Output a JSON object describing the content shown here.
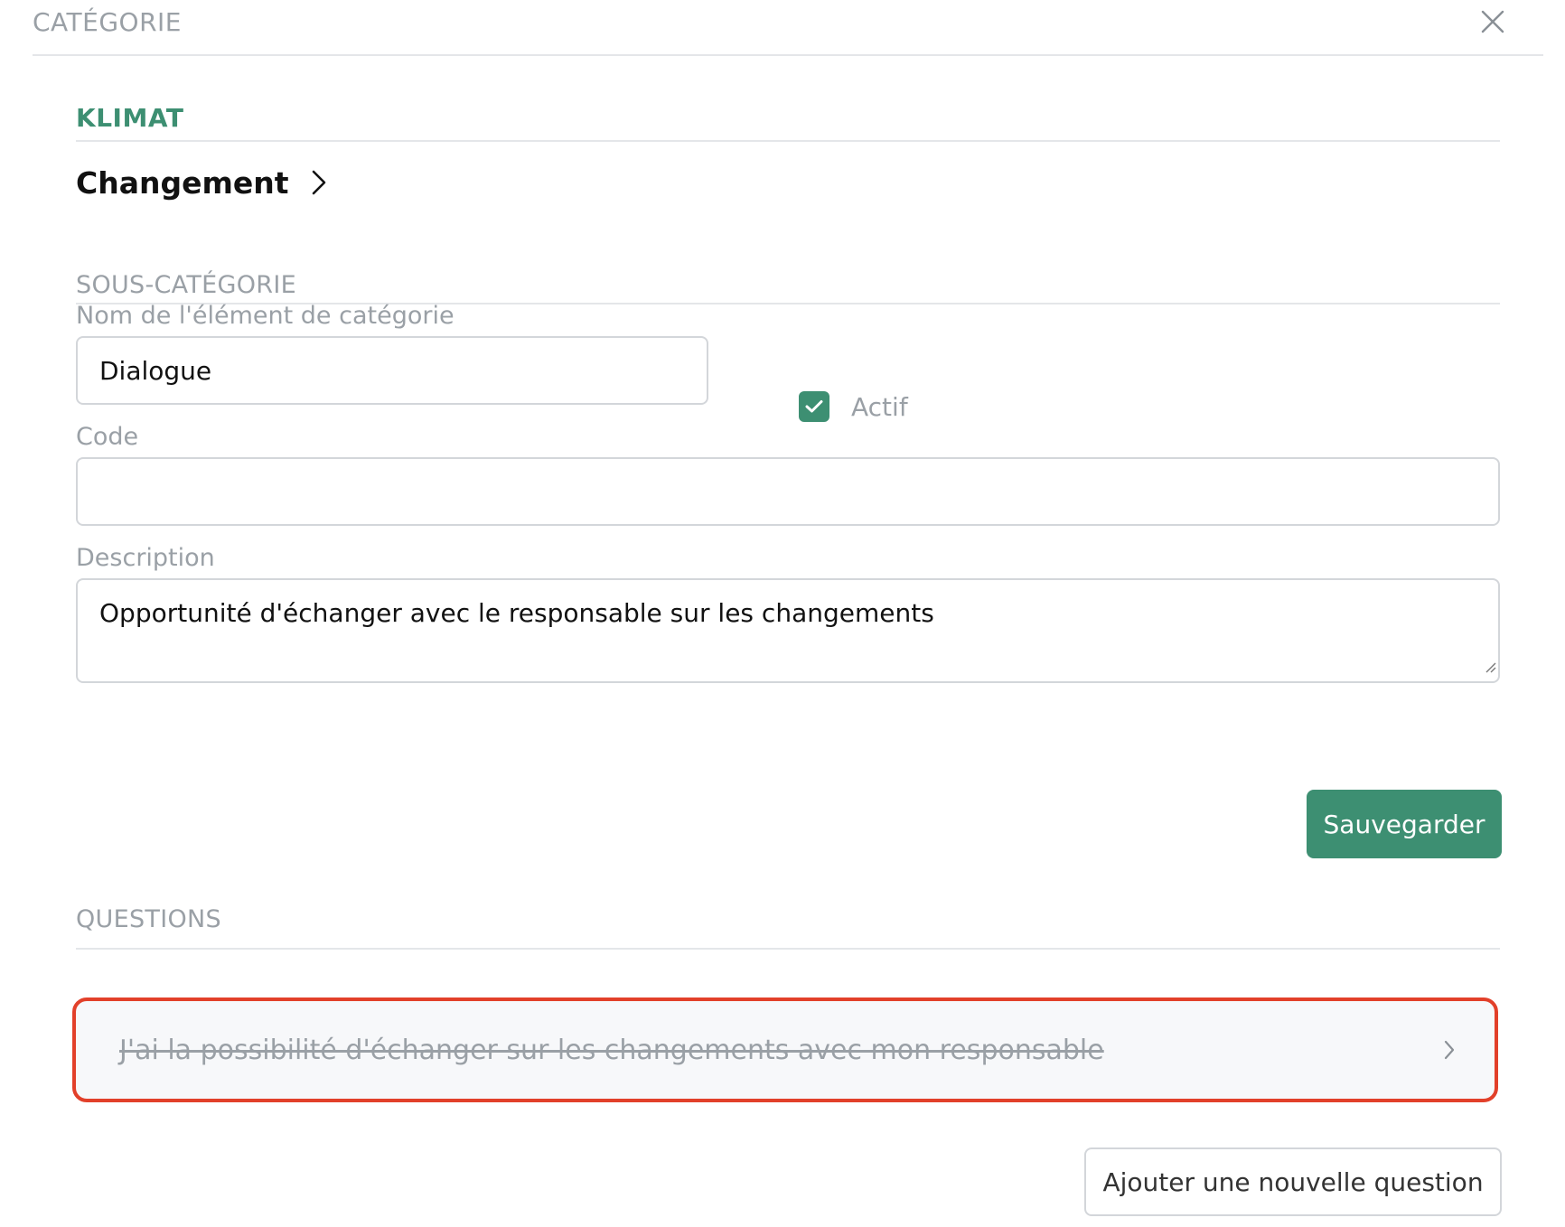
{
  "header": {
    "title": "CATÉGORIE",
    "close_icon": "close-icon"
  },
  "category": {
    "name": "KLIMAT"
  },
  "breadcrumb": {
    "label": "Changement",
    "icon": "chevron-right-icon"
  },
  "subcategory": {
    "section_title": "SOUS-CATÉGORIE",
    "name_label": "Nom de l'élément de catégorie",
    "name_value": "Dialogue",
    "active_label": "Actif",
    "active_checked": true,
    "code_label": "Code",
    "code_value": "",
    "description_label": "Description",
    "description_value": "Opportunité d'échanger avec le responsable sur les changements",
    "save_label": "Sauvegarder"
  },
  "questions": {
    "section_title": "QUESTIONS",
    "items": [
      {
        "text": "J'ai la possibilité d'échanger sur les changements avec mon responsable",
        "struck": true
      }
    ],
    "add_label": "Ajouter une nouvelle question"
  },
  "colors": {
    "accent": "#3d8f72",
    "highlight_border": "#e2402a",
    "muted_text": "#9aa0a6"
  }
}
